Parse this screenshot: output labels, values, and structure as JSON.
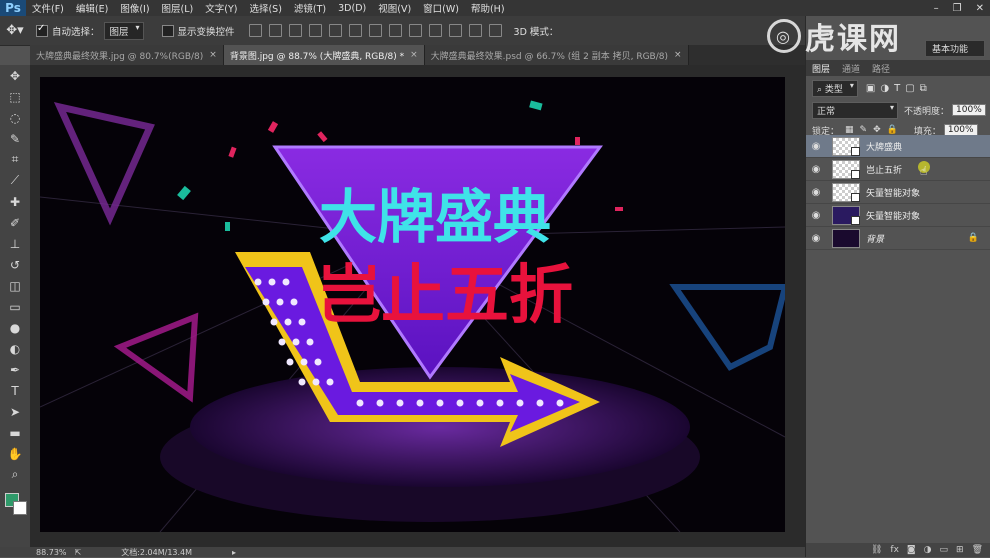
{
  "app": {
    "logo": "Ps"
  },
  "menu": [
    "文件(F)",
    "编辑(E)",
    "图像(I)",
    "图层(L)",
    "文字(Y)",
    "选择(S)",
    "滤镜(T)",
    "3D(D)",
    "视图(V)",
    "窗口(W)",
    "帮助(H)"
  ],
  "window_controls": {
    "minimize": "–",
    "restore": "❐",
    "close": "✕"
  },
  "options": {
    "auto_select_label": "自动选择：",
    "auto_select_value": "图层",
    "show_transform_label": "显示变换控件",
    "mode_3d_label": "3D 模式："
  },
  "tabs": [
    {
      "label": "大牌盛典最终效果.jpg @ 80.7%(RGB/8)",
      "active": false
    },
    {
      "label": "背景图.jpg @ 88.7% (大牌盛典, RGB/8) *",
      "active": true
    },
    {
      "label": "大牌盛典最终效果.psd @ 66.7% (组 2 副本 拷贝, RGB/8)",
      "active": false
    }
  ],
  "canvas_art": {
    "line1": "大牌盛典",
    "line2": "岂止五折"
  },
  "status": {
    "zoom": "88.73%",
    "doc": "文档:2.04M/13.4M"
  },
  "watermark": {
    "text": "虎课网"
  },
  "workspace": {
    "label": "基本功能"
  },
  "panel": {
    "tabs": [
      "图层",
      "通道",
      "路径"
    ],
    "filter_type": "类型",
    "blend_mode": "正常",
    "opacity_label": "不透明度：",
    "opacity_value": "100%",
    "lock_label": "锁定：",
    "fill_label": "填充：",
    "fill_value": "100%",
    "layers": [
      {
        "name": "大牌盛典",
        "selected": true,
        "smart": true,
        "locked": false
      },
      {
        "name": "岂止五折",
        "selected": false,
        "smart": true,
        "locked": false
      },
      {
        "name": "矢量智能对象",
        "selected": false,
        "smart": true,
        "locked": false
      },
      {
        "name": "矢量智能对象",
        "selected": false,
        "smart": true,
        "locked": false
      },
      {
        "name": "背景",
        "selected": false,
        "smart": false,
        "locked": true
      }
    ]
  }
}
